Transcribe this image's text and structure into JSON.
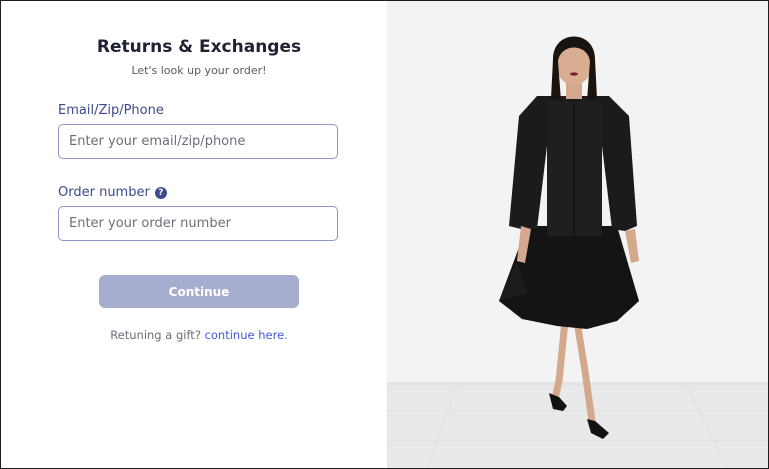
{
  "form": {
    "title": "Returns & Exchanges",
    "subtitle": "Let's look up your order!",
    "email_label": "Email/Zip/Phone",
    "email_placeholder": "Enter your email/zip/phone",
    "order_label": "Order number",
    "order_help_icon": "question-mark-icon",
    "order_help_glyph": "?",
    "order_placeholder": "Enter your order number",
    "continue_label": "Continue",
    "gift_text": "Retuning a gift?",
    "gift_link": "continue here."
  },
  "colors": {
    "label": "#3c4a8c",
    "button_bg": "#a7adcf",
    "link": "#3f5bd6",
    "input_border": "#8f95c4"
  },
  "hero_image": {
    "icon": "model-photo"
  }
}
